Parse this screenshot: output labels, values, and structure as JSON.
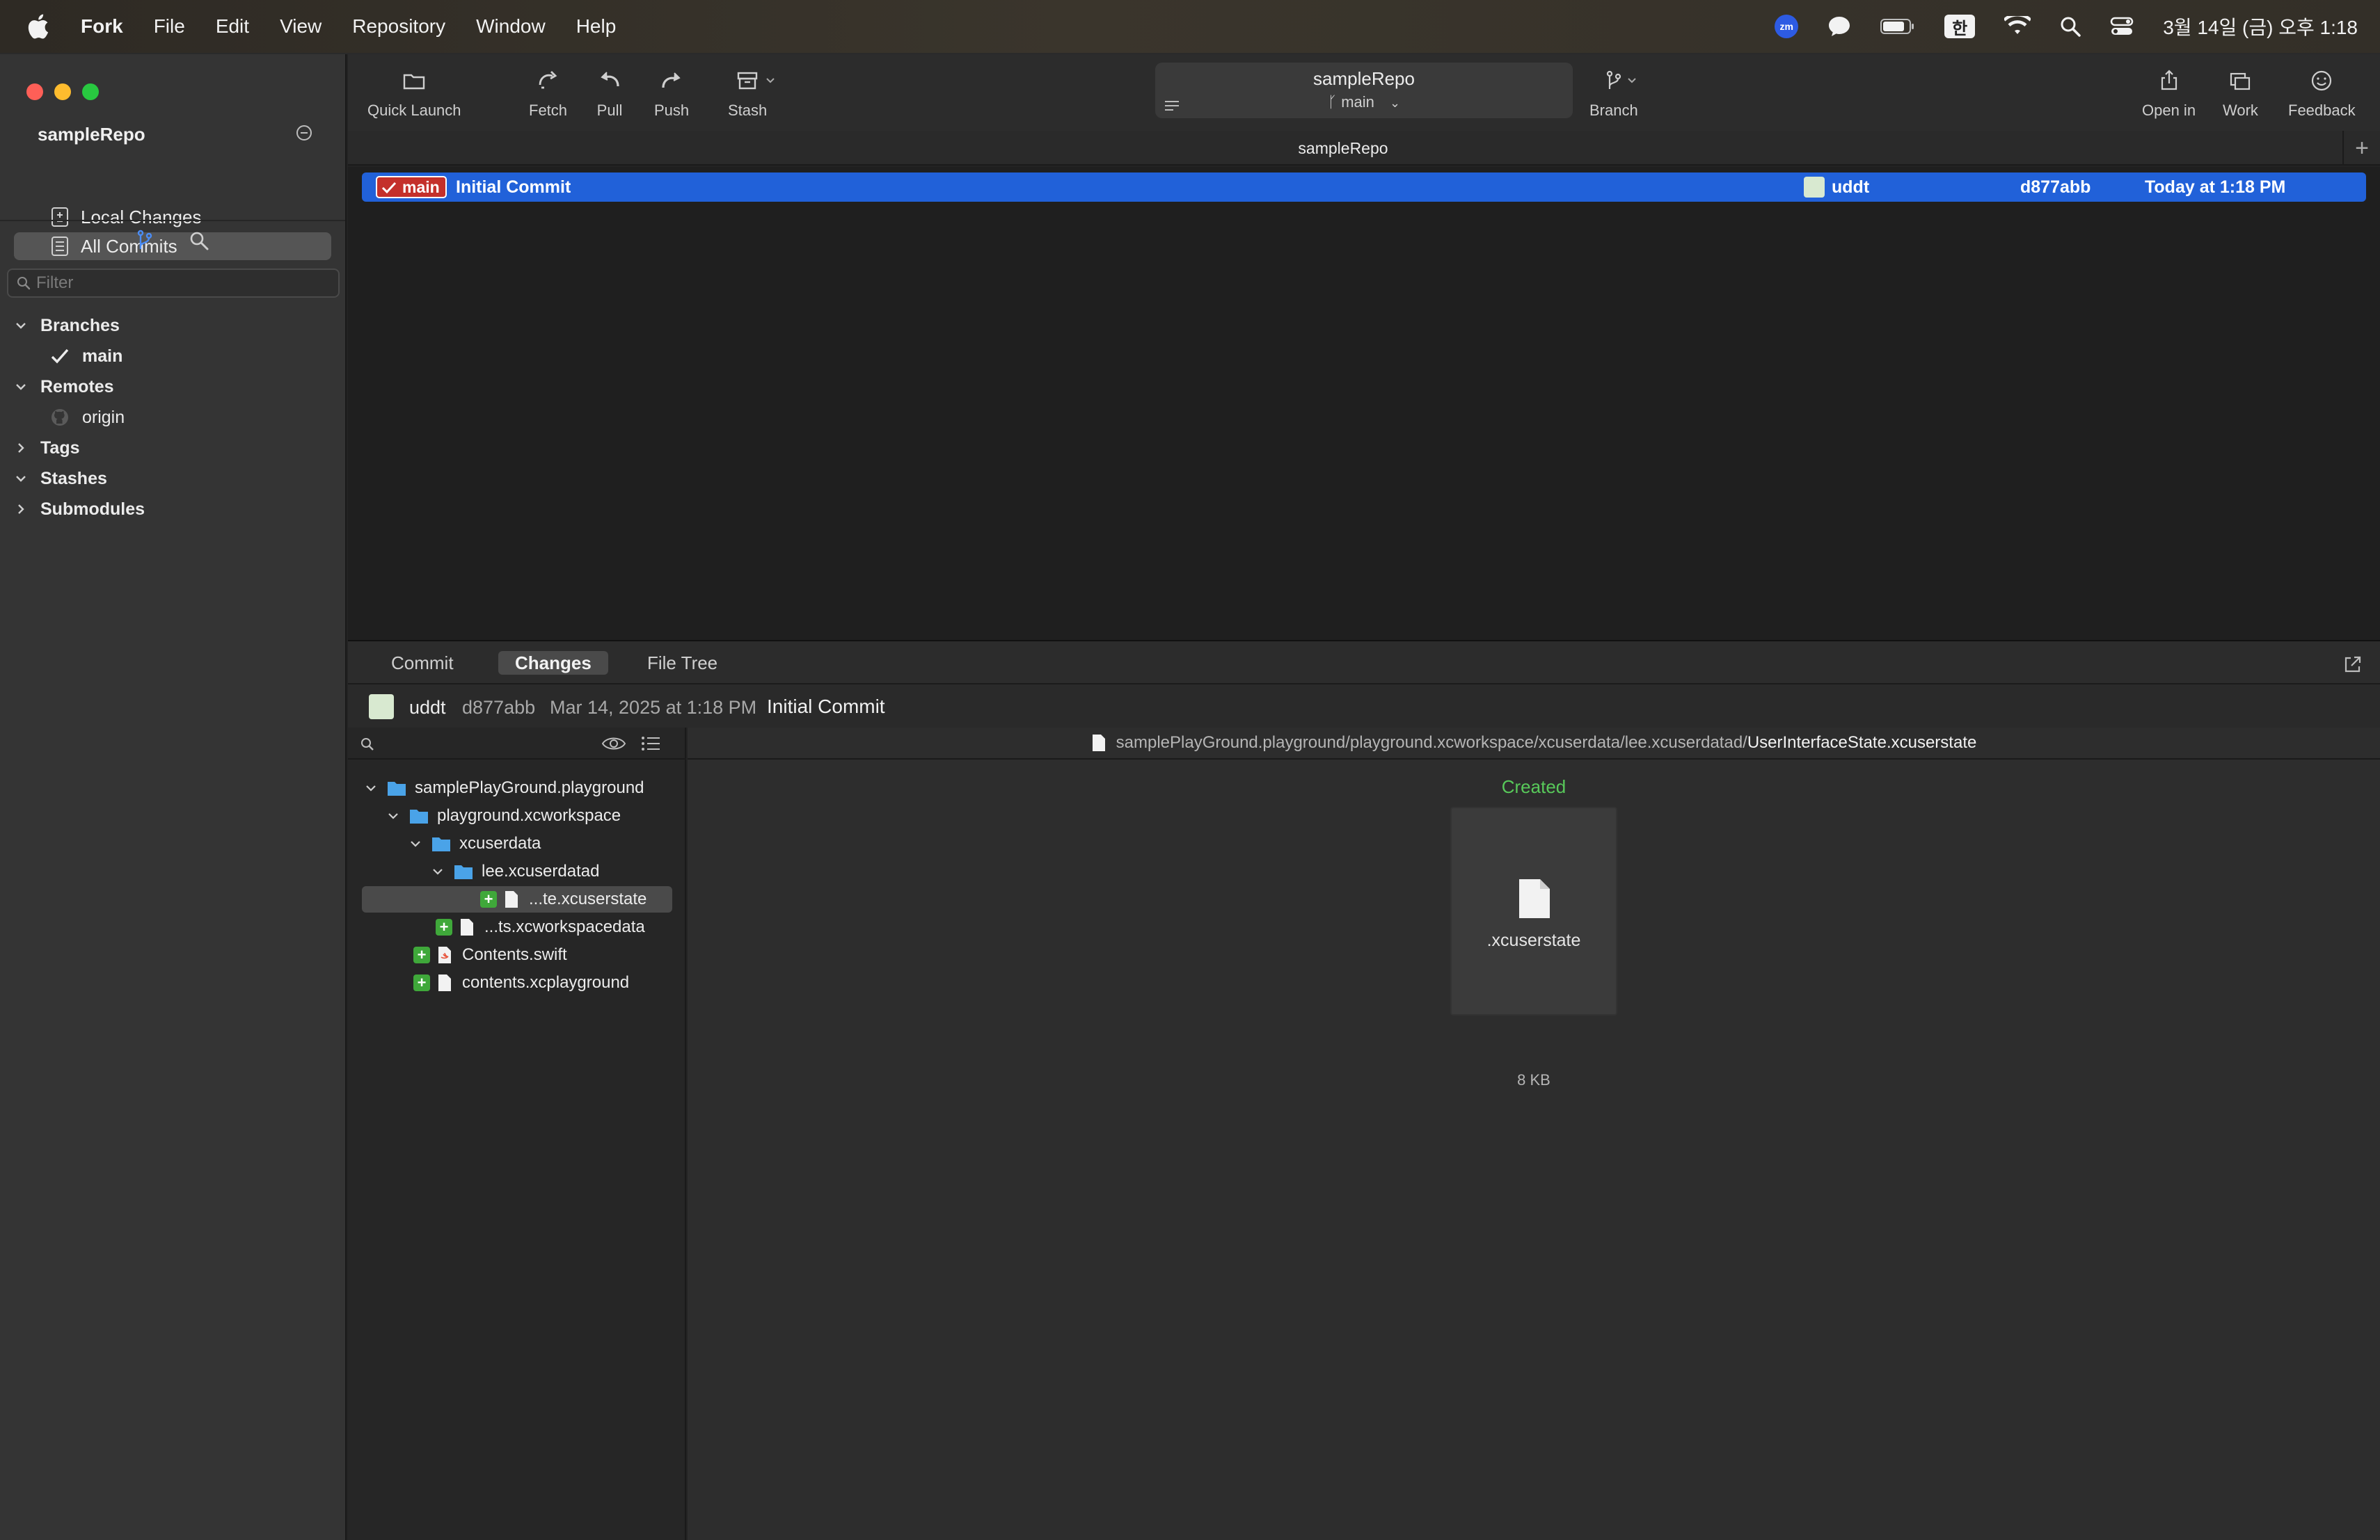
{
  "menubar": {
    "app_name": "Fork",
    "items": [
      "File",
      "Edit",
      "View",
      "Repository",
      "Window",
      "Help"
    ],
    "status": {
      "zoom_label": "zm",
      "ime_label": "한",
      "clock": "3월 14일 (금) 오후 1:18"
    }
  },
  "sidebar": {
    "repo_name": "sampleRepo",
    "nav": {
      "local_changes": "Local Changes",
      "all_commits": "All Commits"
    },
    "filter_placeholder": "Filter",
    "tree": {
      "branches": "Branches",
      "branch_main": "main",
      "remotes": "Remotes",
      "remote_origin": "origin",
      "tags": "Tags",
      "stashes": "Stashes",
      "submodules": "Submodules"
    }
  },
  "toolbar": {
    "quick_launch": "Quick Launch",
    "fetch": "Fetch",
    "pull": "Pull",
    "push": "Push",
    "stash": "Stash",
    "repo_title": "sampleRepo",
    "current_branch": "main",
    "branch": "Branch",
    "open_in": "Open in",
    "work": "Work",
    "feedback": "Feedback"
  },
  "tabstrip": {
    "tab": "sampleRepo",
    "add": "+"
  },
  "commits": [
    {
      "branch": "main",
      "message": "Initial Commit",
      "author": "uddt",
      "sha": "d877abb",
      "date": "Today at 1:18 PM"
    }
  ],
  "details": {
    "tabs": {
      "commit": "Commit",
      "changes": "Changes",
      "file_tree": "File Tree"
    },
    "author": "uddt",
    "sha": "d877abb",
    "date": "Mar 14, 2025 at 1:18 PM",
    "message": "Initial Commit"
  },
  "files": {
    "root": "samplePlayGround.playground",
    "workspace": "playground.xcworkspace",
    "xcuserdata": "xcuserdata",
    "xcuserdatad": "lee.xcuserdatad",
    "xcuserstate": "...te.xcuserstate",
    "workspacedata": "...ts.xcworkspacedata",
    "contents_swift": "Contents.swift",
    "contents_xcplayground": "contents.xcplayground"
  },
  "diff": {
    "path_prefix": "samplePlayGround.playground/playground.xcworkspace/xcuserdata/lee.xcuserdatad/",
    "path_file": "UserInterfaceState.xcuserstate",
    "status": "Created",
    "file_ext": ".xcuserstate",
    "file_size": "8 KB"
  },
  "colors": {
    "accent": "#2161d9",
    "branch_tag": "#c4302b",
    "added": "#3fa83a",
    "created_text": "#58c95a",
    "folder": "#4aa3e8"
  }
}
